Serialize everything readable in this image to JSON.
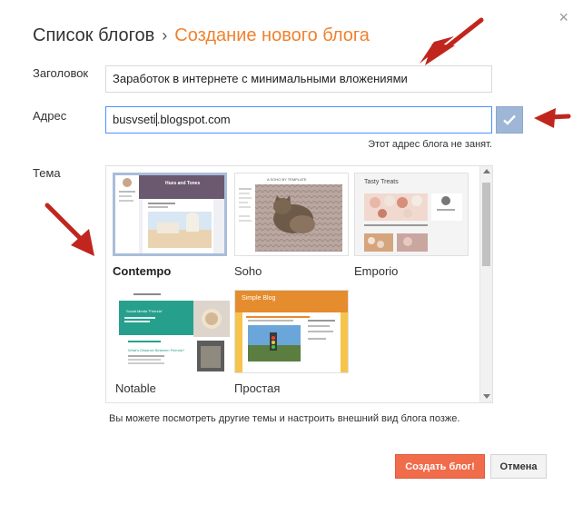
{
  "dialog": {
    "close_symbol": "×",
    "breadcrumb": {
      "parent": "Список блогов",
      "separator": "›",
      "current": "Создание нового блога"
    }
  },
  "form": {
    "title_label": "Заголовок",
    "title_value": "Заработок в интернете с минимальными вложениями",
    "address_label": "Адрес",
    "address_value_before_caret": "busvseti",
    "address_value_after_caret": ".blogspot.com",
    "address_status": "Этот адрес блога не занят.",
    "theme_label": "Тема"
  },
  "themes": [
    {
      "name": "Contempo",
      "selected": true
    },
    {
      "name": "Soho",
      "selected": false
    },
    {
      "name": "Emporio",
      "selected": false
    },
    {
      "name": "Notable",
      "selected": false
    },
    {
      "name": "Простая",
      "selected": false
    }
  ],
  "thumbnails": {
    "contempo_heading": "Hues and Tones",
    "soho_heading": "A SOHO BY TEMPLATE",
    "emporio_heading": "Tasty Treats",
    "notable_post_title": "Social Media \"Friends\"",
    "notable_post_title_2": "What's Distance Between Friends?",
    "simple_heading": "Simple Blog"
  },
  "footer": {
    "note": "Вы можете посмотреть другие темы и настроить внешний вид блога позже.",
    "create_label": "Создать блог!",
    "cancel_label": "Отмена"
  },
  "colors": {
    "accent": "#f0812f",
    "primary_button": "#f06c4b",
    "arrow": "#c0261d"
  },
  "icons": [
    "close-icon",
    "checkmark-icon",
    "arrow-annotation"
  ]
}
